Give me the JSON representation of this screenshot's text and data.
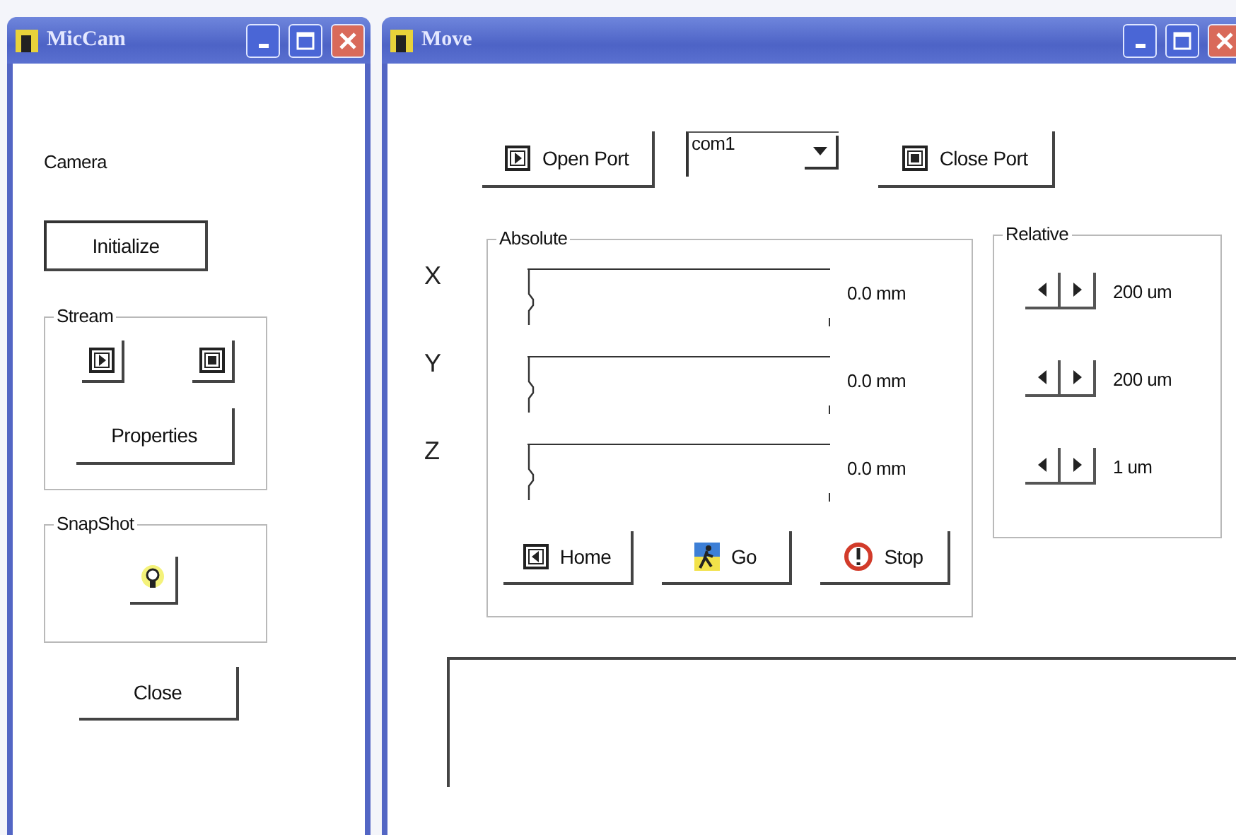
{
  "camera_window": {
    "title": "MicCam",
    "label": "Camera",
    "initialize_button": "Initialize",
    "stream": {
      "title": "Stream",
      "properties_button": "Properties"
    },
    "snapshot": {
      "title": "SnapShot"
    },
    "close_button": "Close"
  },
  "move_window": {
    "title": "Move",
    "open_port_button": "Open Port",
    "port_select": {
      "value": "com1"
    },
    "close_port_button": "Close Port",
    "absolute": {
      "title": "Absolute",
      "axes": [
        {
          "label": "X",
          "level": 0,
          "reading": "0.0 mm"
        },
        {
          "label": "Y",
          "level": 0,
          "reading": "0.0 mm"
        },
        {
          "label": "Z",
          "level": 0,
          "reading": "0.0 mm"
        }
      ],
      "buttons": [
        {
          "kind": "home",
          "label": "Home"
        },
        {
          "kind": "go",
          "label": "Go"
        },
        {
          "kind": "stop",
          "label": "Stop"
        }
      ]
    },
    "relative": {
      "title": "Relative",
      "steps": [
        {
          "reading": "200 um"
        },
        {
          "reading": "200 um"
        },
        {
          "reading": "1 um"
        }
      ]
    }
  }
}
